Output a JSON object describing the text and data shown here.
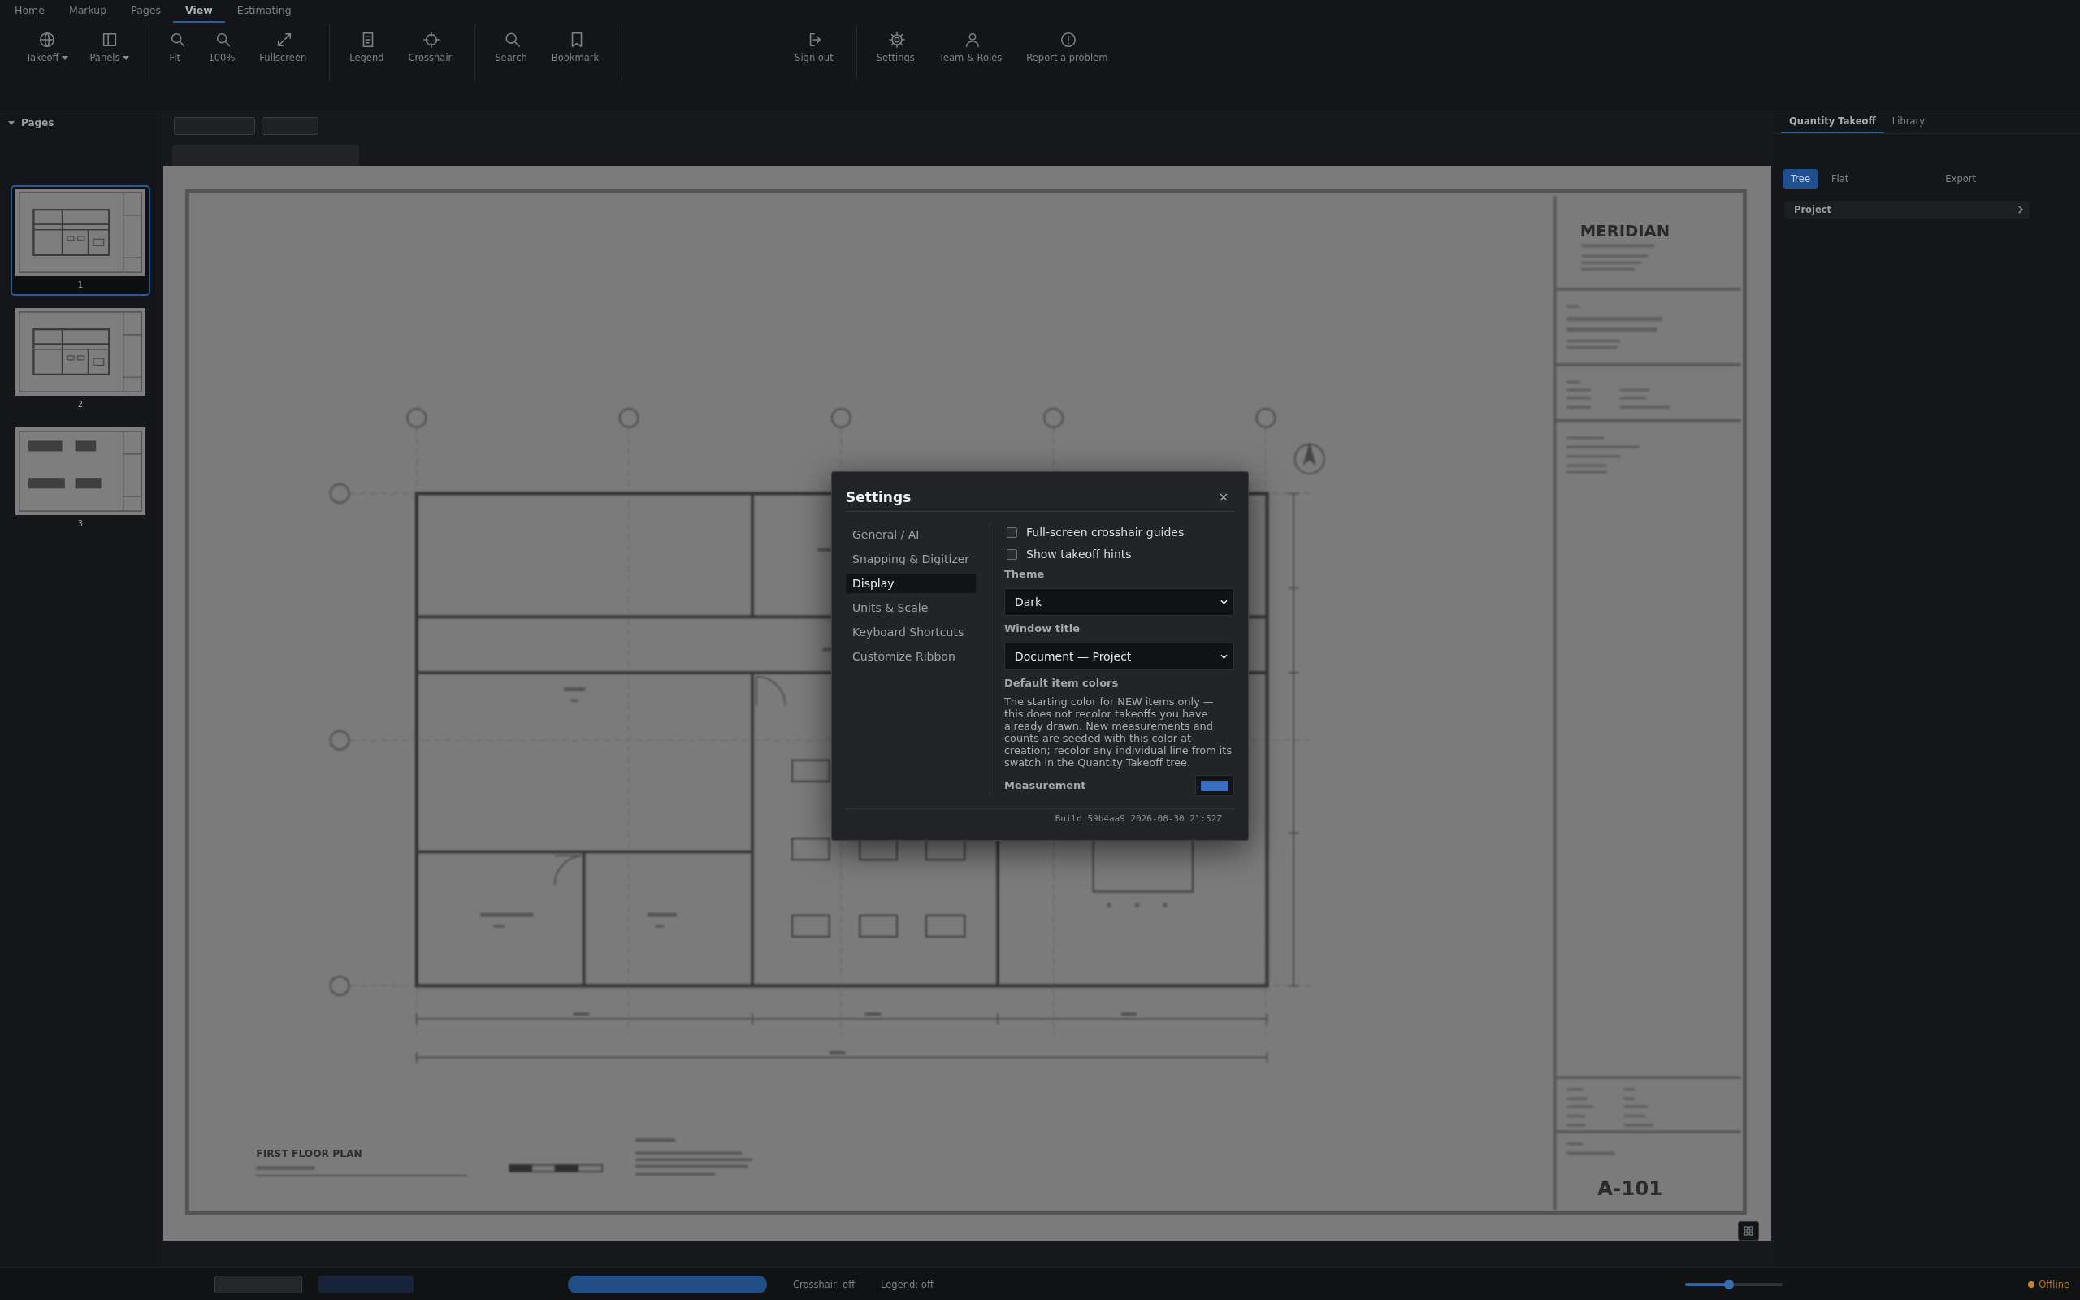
{
  "ribbon_tabs": [
    {
      "label": "Home",
      "selected": false
    },
    {
      "label": "Markup",
      "selected": false
    },
    {
      "label": "Pages",
      "selected": false
    },
    {
      "label": "View",
      "selected": true
    },
    {
      "label": "Estimating",
      "selected": false
    }
  ],
  "ribbon_groups": [
    {
      "buttons": [
        {
          "label": "Takeoff",
          "kind": "menu"
        },
        {
          "label": "Panels",
          "kind": "menu"
        }
      ]
    },
    {
      "buttons": [
        {
          "label": "Fit",
          "kind": "button"
        },
        {
          "label": "100%",
          "kind": "button"
        },
        {
          "label": "Fullscreen",
          "kind": "button"
        }
      ]
    },
    {
      "buttons": [
        {
          "label": "Legend",
          "kind": "button"
        },
        {
          "label": "Crosshair",
          "kind": "button"
        }
      ]
    },
    {
      "buttons": [
        {
          "label": "Search",
          "kind": "button"
        },
        {
          "label": "Bookmark",
          "kind": "button"
        }
      ]
    },
    {
      "buttons": [
        {
          "label": "Sign out",
          "kind": "button"
        }
      ]
    },
    {
      "buttons": [
        {
          "label": "Settings",
          "kind": "button"
        },
        {
          "label": "Team & Roles",
          "kind": "button"
        },
        {
          "label": "Report a problem",
          "kind": "button"
        }
      ]
    }
  ],
  "pages_panel": {
    "title": "Pages",
    "pages": [
      {
        "number": "1",
        "selected": true
      },
      {
        "number": "2",
        "selected": false
      },
      {
        "number": "3",
        "selected": false
      }
    ]
  },
  "sheet": {
    "logo": "MERIDIAN",
    "drawing_title": "FIRST FLOOR PLAN",
    "sheet_number": "A-101"
  },
  "takeoff_panel": {
    "tabs": [
      {
        "label": "Quantity Takeoff",
        "selected": true
      },
      {
        "label": "Library",
        "selected": false
      }
    ],
    "view_buttons": [
      {
        "label": "Tree",
        "selected": true
      },
      {
        "label": "Flat",
        "selected": false
      }
    ],
    "export": "Export",
    "tree": [
      {
        "label": "Project"
      }
    ]
  },
  "status_bar": {
    "toggles": [
      {
        "label": "Crosshair: off"
      },
      {
        "label": "Legend: off"
      }
    ],
    "zoom_slider": {
      "level": 0.45
    },
    "connection": {
      "label": "Offline",
      "color": "#c2862c"
    }
  },
  "settings_dialog": {
    "title": "Settings",
    "nav": [
      {
        "label": "General / AI",
        "selected": false
      },
      {
        "label": "Snapping & Digitizer",
        "selected": false
      },
      {
        "label": "Display",
        "selected": true
      },
      {
        "label": "Units & Scale",
        "selected": false
      },
      {
        "label": "Keyboard Shortcuts",
        "selected": false
      },
      {
        "label": "Customize Ribbon",
        "selected": false
      }
    ],
    "checkboxes": [
      {
        "label": "Full-screen crosshair guides",
        "checked": false
      },
      {
        "label": "Show takeoff hints",
        "checked": false
      }
    ],
    "selects": [
      {
        "label": "Theme",
        "value": "Dark"
      },
      {
        "label": "Window title",
        "value": "Document — Project"
      }
    ],
    "item_colors": {
      "title": "Default item colors",
      "description": "The starting color for NEW items only — this does not recolor takeoffs you have already drawn. New measurements and counts are seeded with this color at creation; recolor any individual line from its swatch in the Quantity Takeoff tree.",
      "items": [
        {
          "label": "Measurement",
          "color": "#3b6ec2"
        }
      ]
    },
    "build": "Build 59b4aa9 2026-08-30 21:52Z"
  }
}
